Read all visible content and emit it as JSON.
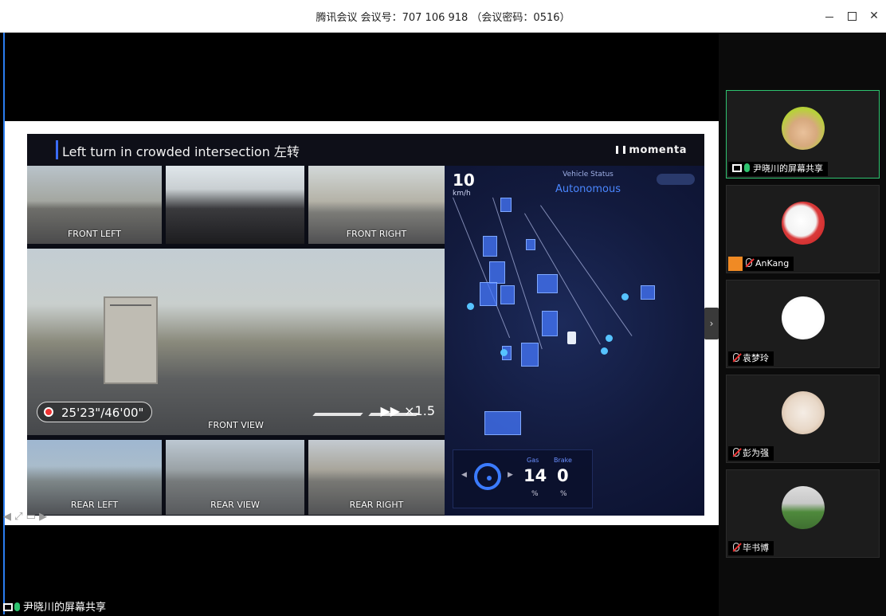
{
  "window": {
    "title": "腾讯会议 会议号：707 106 918 （会议密码：0516）"
  },
  "slide": {
    "title": "Left turn in crowded intersection  左转",
    "brand": "momenta",
    "cameras": {
      "front_left": "FRONT LEFT",
      "front_right": "FRONT RIGHT",
      "front_view": "FRONT VIEW",
      "rear_left": "REAR LEFT",
      "rear_view": "REAR VIEW",
      "rear_right": "REAR RIGHT"
    },
    "record_time": "25'23\"/46'00\"",
    "playback_speed": "▶▶ ×1.5",
    "map": {
      "speed": "10",
      "speed_unit": "km/h",
      "status_label": "Vehicle Status",
      "status_value": "Autonomous",
      "gas_label": "Gas",
      "gas_value": "14",
      "gas_unit": "%",
      "brake_label": "Brake",
      "brake_value": "0",
      "brake_unit": "%"
    }
  },
  "presenter": {
    "label": "尹晓川的屏幕共享"
  },
  "participants": [
    {
      "name": "尹晓川的屏幕共享",
      "muted": false,
      "sharing": true
    },
    {
      "name": "AnKang",
      "muted": true
    },
    {
      "name": "袁梦玲",
      "muted": true
    },
    {
      "name": "彭为强",
      "muted": true
    },
    {
      "name": "毕书博",
      "muted": true
    }
  ],
  "icons": {
    "nav": "◀ ⤢ ▭ ▶",
    "collapse": "›"
  }
}
